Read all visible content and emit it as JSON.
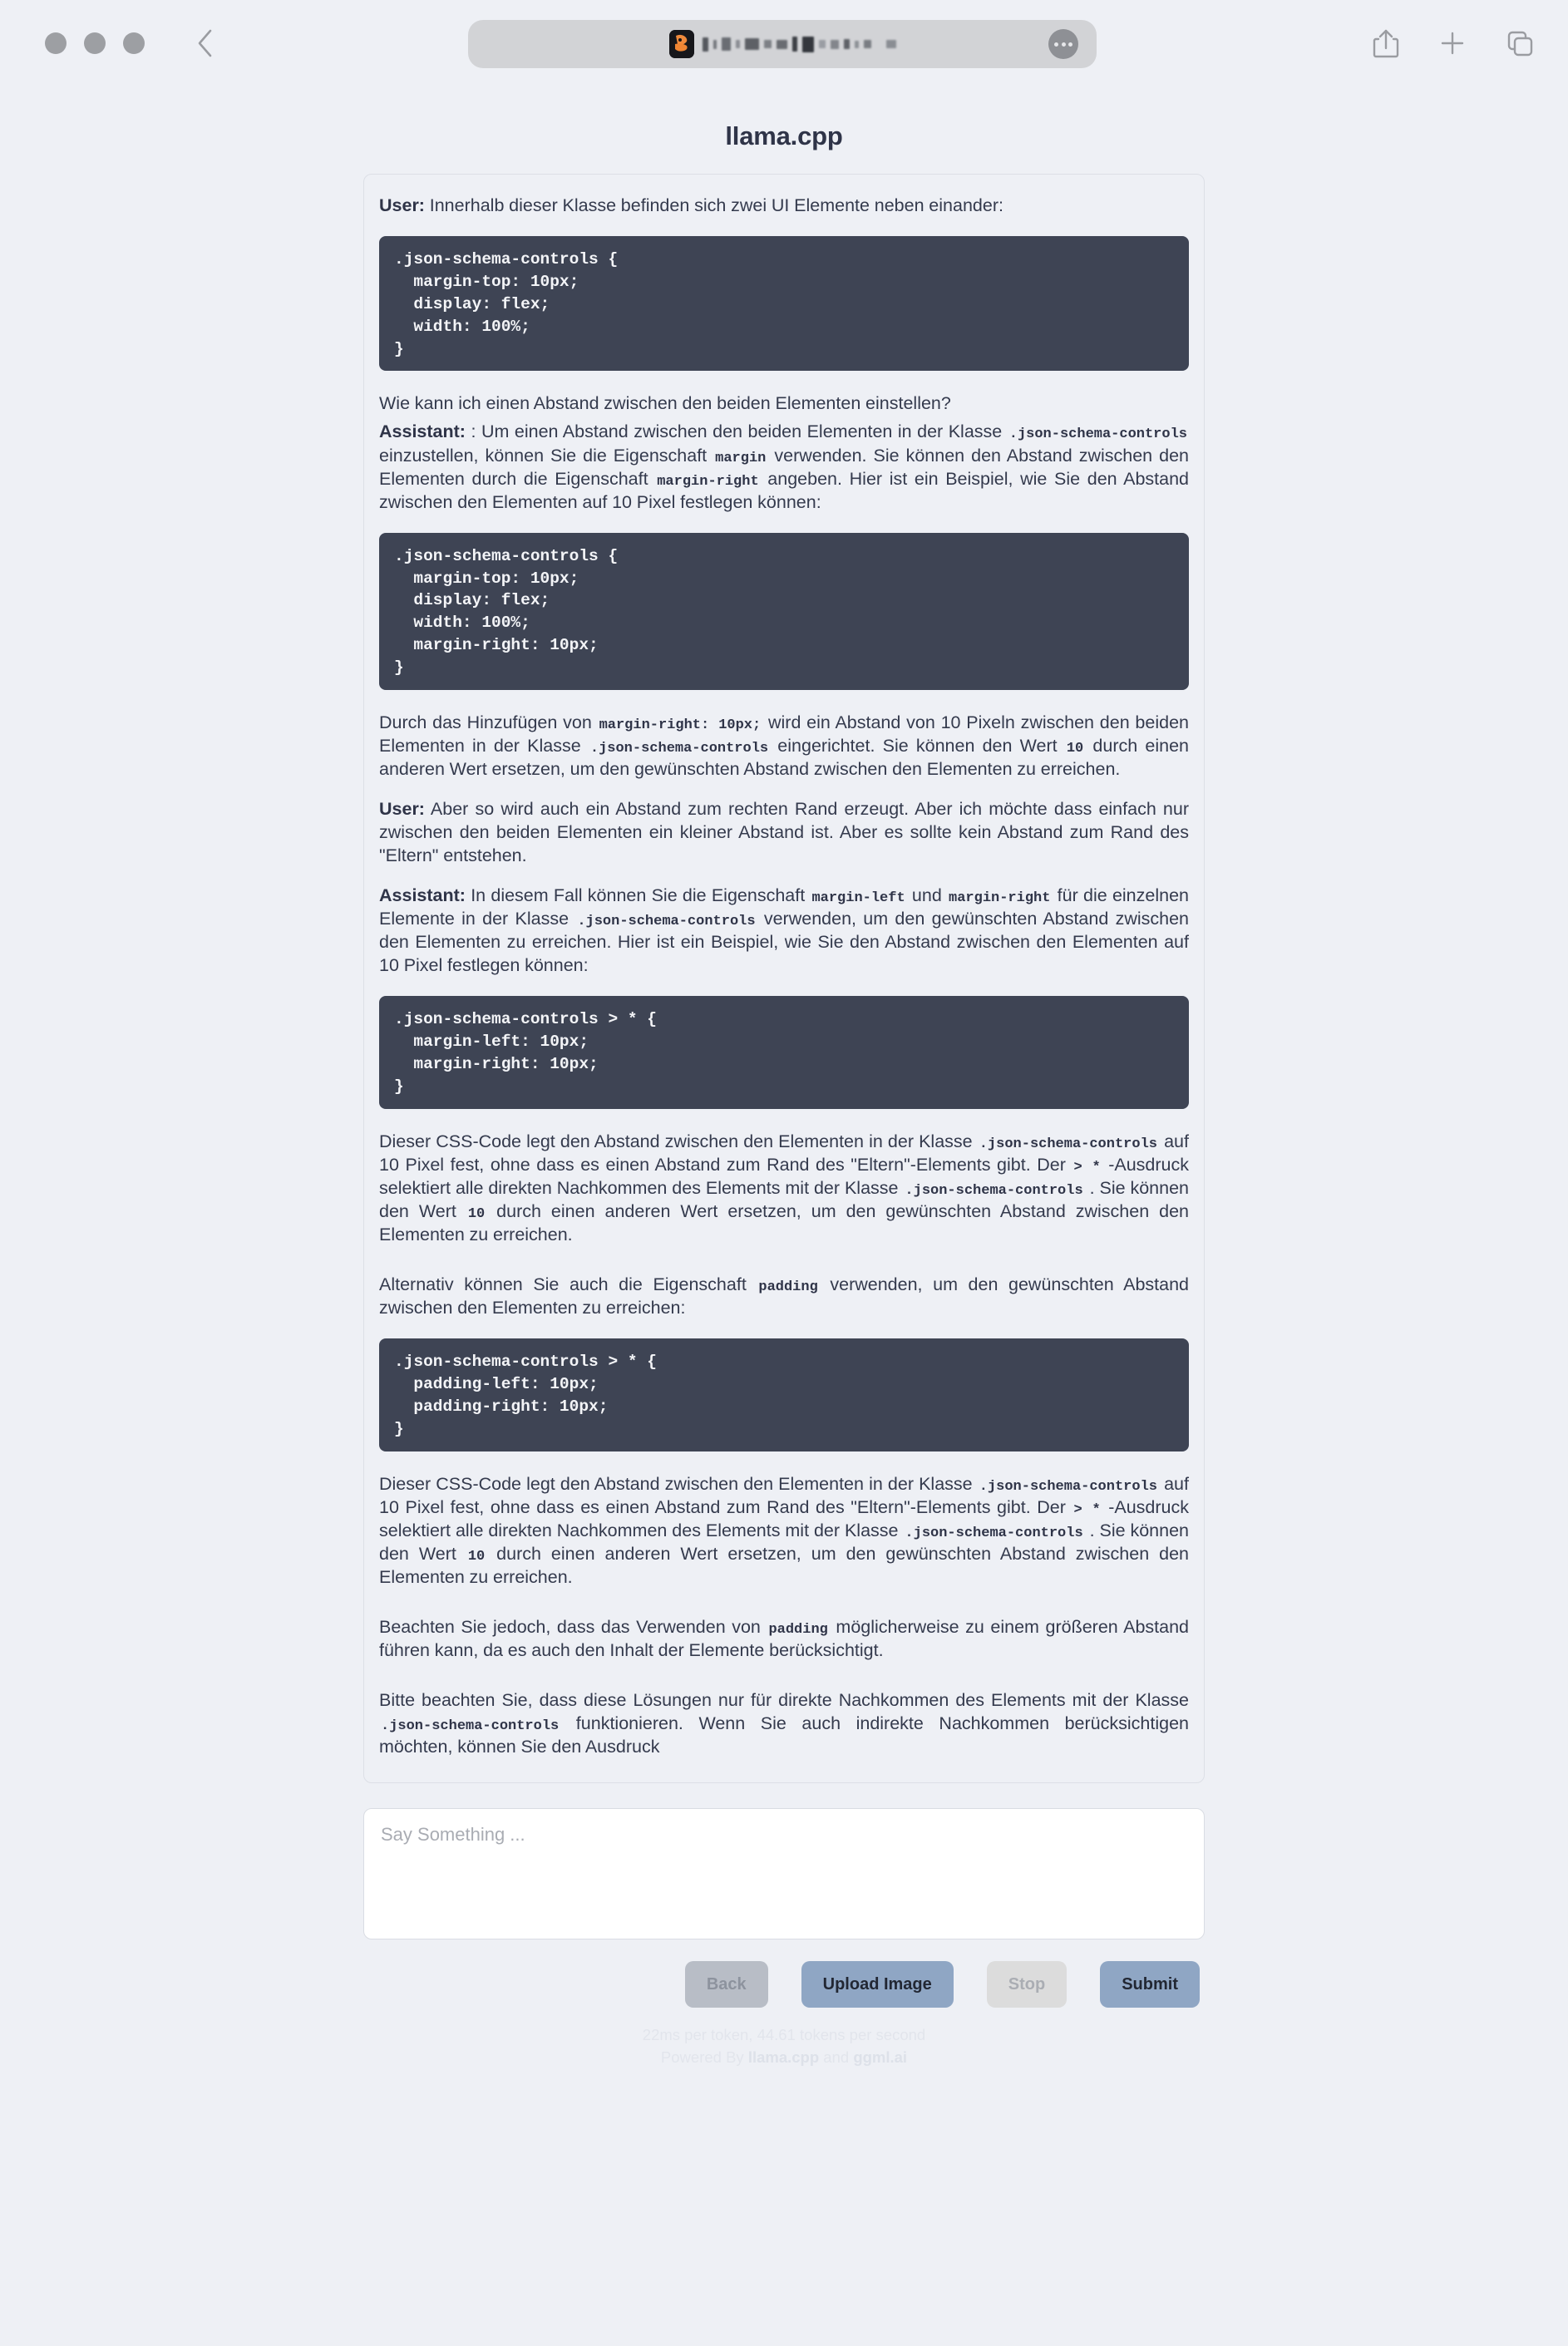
{
  "browser": {
    "traffic_lights": [
      "close",
      "minimize",
      "zoom"
    ],
    "back_icon": "chevron-left-icon",
    "url_text_redacted": true,
    "favicon": "llama-cpp-favicon",
    "more_icon": "ellipsis-icon",
    "right_icons": [
      "share-icon",
      "new-tab-icon",
      "tab-overview-icon"
    ]
  },
  "page": {
    "title": "llama.cpp"
  },
  "chat": {
    "turns": [
      {
        "role": "User:",
        "text": " Innerhalb dieser Klasse befinden sich zwei UI Elemente neben einander:"
      }
    ],
    "code1": ".json-schema-controls {\n  margin-top: 10px;\n  display: flex;\n  width: 100%;\n}",
    "q1": "Wie kann ich einen Abstand zwischen den beiden Elementen einstellen?",
    "a1": {
      "role": "Assistant:",
      "p1a": " : Um einen Abstand zwischen den beiden Elementen in der Klasse ",
      "c1": ".json-schema-controls",
      "p1b": " einzustellen, können Sie die Eigenschaft ",
      "c2": "margin",
      "p1c": " verwenden. Sie können den Abstand zwischen den Elementen durch die Eigenschaft ",
      "c3": "margin-right",
      "p1d": " angeben. Hier ist ein Beispiel, wie Sie den Abstand zwischen den Elementen auf 10 Pixel festlegen können:"
    },
    "code2": ".json-schema-controls {\n  margin-top: 10px;\n  display: flex;\n  width: 100%;\n  margin-right: 10px;\n}",
    "a1after": {
      "p1": "Durch das Hinzufügen von ",
      "c1": "margin-right: 10px;",
      "p2": " wird ein Abstand von 10 Pixeln zwischen den beiden Elementen in der Klasse ",
      "c2": ".json-schema-controls",
      "p3": " eingerichtet. Sie können den Wert ",
      "c3": "10",
      "p4": " durch einen anderen Wert ersetzen, um den gewünschten Abstand zwischen den Elementen zu erreichen."
    },
    "u2": {
      "role": "User:",
      "text": " Aber so wird auch ein Abstand zum rechten Rand erzeugt. Aber ich möchte dass einfach nur zwischen den beiden Elementen ein kleiner Abstand ist. Aber es sollte kein Abstand zum Rand des \"Eltern\" entstehen."
    },
    "a2": {
      "role": "Assistant:",
      "p1": " In diesem Fall können Sie die Eigenschaft ",
      "c1": "margin-left",
      "p2": " und ",
      "c2": "margin-right",
      "p3": " für die einzelnen Elemente in der Klasse ",
      "c3": ".json-schema-controls",
      "p4": " verwenden, um den gewünschten Abstand zwischen den Elementen zu erreichen. Hier ist ein Beispiel, wie Sie den Abstand zwischen den Elementen auf 10 Pixel festlegen können:"
    },
    "code3": ".json-schema-controls > * {\n  margin-left: 10px;\n  margin-right: 10px;\n}",
    "a2after": {
      "p1": "Dieser CSS-Code legt den Abstand zwischen den Elementen in der Klasse ",
      "c1": ".json-schema-controls",
      "p2": " auf 10 Pixel fest, ohne dass es einen Abstand zum Rand des \"Eltern\"-Elements gibt. Der ",
      "c2": "> *",
      "p3": " -Ausdruck selektiert alle direkten Nachkommen des Elements mit der Klasse ",
      "c3": ".json-schema-controls",
      "p4": " . Sie können den Wert ",
      "c4": "10",
      "p5": " durch einen anderen Wert ersetzen, um den gewünschten Abstand zwischen den Elementen zu erreichen."
    },
    "alt": {
      "p1": "Alternativ können Sie auch die Eigenschaft ",
      "c1": "padding",
      "p2": " verwenden, um den gewünschten Abstand zwischen den Elementen zu erreichen:"
    },
    "code4": ".json-schema-controls > * {\n  padding-left: 10px;\n  padding-right: 10px;\n}",
    "a3after": {
      "p1": "Dieser CSS-Code legt den Abstand zwischen den Elementen in der Klasse ",
      "c1": ".json-schema-controls",
      "p2": " auf 10 Pixel fest, ohne dass es einen Abstand zum Rand des \"Eltern\"-Elements gibt. Der ",
      "c2": "> *",
      "p3": " -Ausdruck selektiert alle direkten Nachkommen des Elements mit der Klasse ",
      "c3": ".json-schema-controls",
      "p4": " . Sie können den Wert ",
      "c4": "10",
      "p5": " durch einen anderen Wert ersetzen, um den gewünschten Abstand zwischen den Elementen zu erreichen."
    },
    "note1": {
      "p1": "Beachten Sie jedoch, dass das Verwenden von ",
      "c1": "padding",
      "p2": " möglicherweise zu einem größeren Abstand führen kann, da es auch den Inhalt der Elemente berücksichtigt."
    },
    "note2": {
      "p1": "Bitte beachten Sie, dass diese Lösungen nur für direkte Nachkommen des Elements mit der Klasse ",
      "c1": ".json-schema-controls",
      "p2": " funktionieren. Wenn Sie auch indirekte Nachkommen berücksichtigen möchten, können Sie den Ausdruck"
    }
  },
  "composer": {
    "placeholder": "Say Something ...",
    "value": ""
  },
  "buttons": {
    "back": "Back",
    "upload": "Upload Image",
    "stop": "Stop",
    "submit": "Submit"
  },
  "footer": {
    "stats": "22ms per token, 44.61 tokens per second",
    "powered_prefix": "Powered By ",
    "powered_brand1": "llama.cpp",
    "powered_mid": " and ",
    "powered_brand2": "ggml.ai"
  },
  "colors": {
    "page_bg": "#eef0f5",
    "code_bg": "#3e4454",
    "accent_button": "#8fa6c4",
    "text": "#343a4d"
  }
}
